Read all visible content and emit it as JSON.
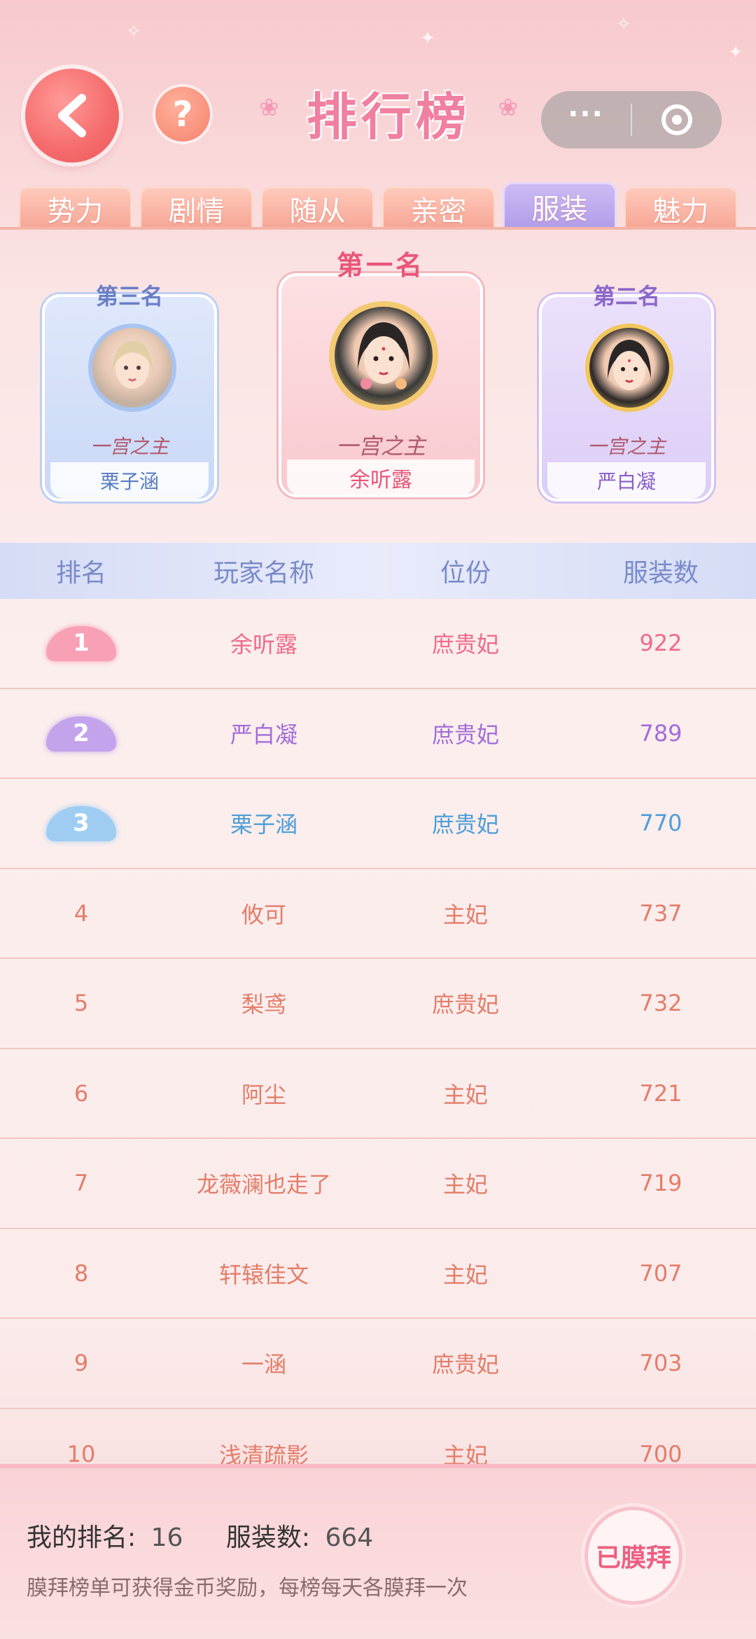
{
  "header": {
    "title": "排行榜",
    "help_label": "?"
  },
  "tabs": [
    {
      "label": "势力",
      "active": false
    },
    {
      "label": "剧情",
      "active": false
    },
    {
      "label": "随从",
      "active": false
    },
    {
      "label": "亲密",
      "active": false
    },
    {
      "label": "服装",
      "active": true
    },
    {
      "label": "魅力",
      "active": false
    }
  ],
  "podium": {
    "first": {
      "place": "第一名",
      "name": "余听露",
      "badge": "一宫之主"
    },
    "second": {
      "place": "第二名",
      "name": "严白凝",
      "badge": "一宫之主"
    },
    "third": {
      "place": "第三名",
      "name": "栗子涵",
      "badge": "一宫之主"
    }
  },
  "table": {
    "headers": {
      "rank": "排名",
      "name": "玩家名称",
      "title": "位份",
      "count": "服装数"
    },
    "rows": [
      {
        "rank": "1",
        "name": "余听露",
        "title": "庶贵妃",
        "count": "922"
      },
      {
        "rank": "2",
        "name": "严白凝",
        "title": "庶贵妃",
        "count": "789"
      },
      {
        "rank": "3",
        "name": "栗子涵",
        "title": "庶贵妃",
        "count": "770"
      },
      {
        "rank": "4",
        "name": "攸可",
        "title": "主妃",
        "count": "737"
      },
      {
        "rank": "5",
        "name": "梨鸢",
        "title": "庶贵妃",
        "count": "732"
      },
      {
        "rank": "6",
        "name": "阿尘",
        "title": "主妃",
        "count": "721"
      },
      {
        "rank": "7",
        "name": "龙薇澜也走了",
        "title": "主妃",
        "count": "719"
      },
      {
        "rank": "8",
        "name": "轩辕佳文",
        "title": "主妃",
        "count": "707"
      },
      {
        "rank": "9",
        "name": "一涵",
        "title": "庶贵妃",
        "count": "703"
      },
      {
        "rank": "10",
        "name": "浅清疏影",
        "title": "主妃",
        "count": "700"
      }
    ]
  },
  "footer": {
    "my_rank_label": "我的排名:",
    "my_rank_value": "16",
    "count_label": "服装数:",
    "count_value": "664",
    "tip": "膜拜榜单可获得金币奖励，每榜每天各膜拜一次",
    "bow_button": "已膜拜"
  },
  "colors": {
    "rank1": "#f06a8c",
    "rank2": "#a36dd8",
    "rank3": "#4e9ed8",
    "default_row": "#e37d6a",
    "active_tab": "#b19de8"
  }
}
